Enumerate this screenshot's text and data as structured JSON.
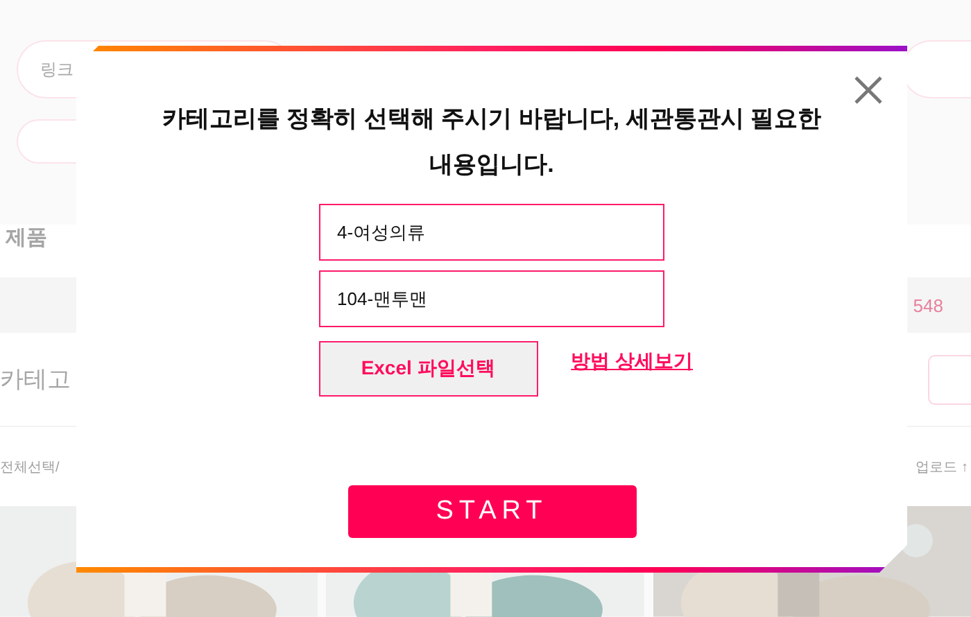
{
  "background": {
    "link_field": {
      "placeholder": "링크"
    },
    "section_title": "제품",
    "count": "548",
    "category_label": "카테고",
    "select_all": "전체선택/",
    "upload": "업로드 ↑"
  },
  "dialog": {
    "message": "카테고리를 정확히 선택해 주시기 바랍니다, 세관통관시 필요한 내용입니다.",
    "category": "4-여성의류",
    "subcategory": "104-맨투맨",
    "file_button": "Excel 파일선택",
    "help_link": "방법 상세보기",
    "start_button": "START"
  }
}
